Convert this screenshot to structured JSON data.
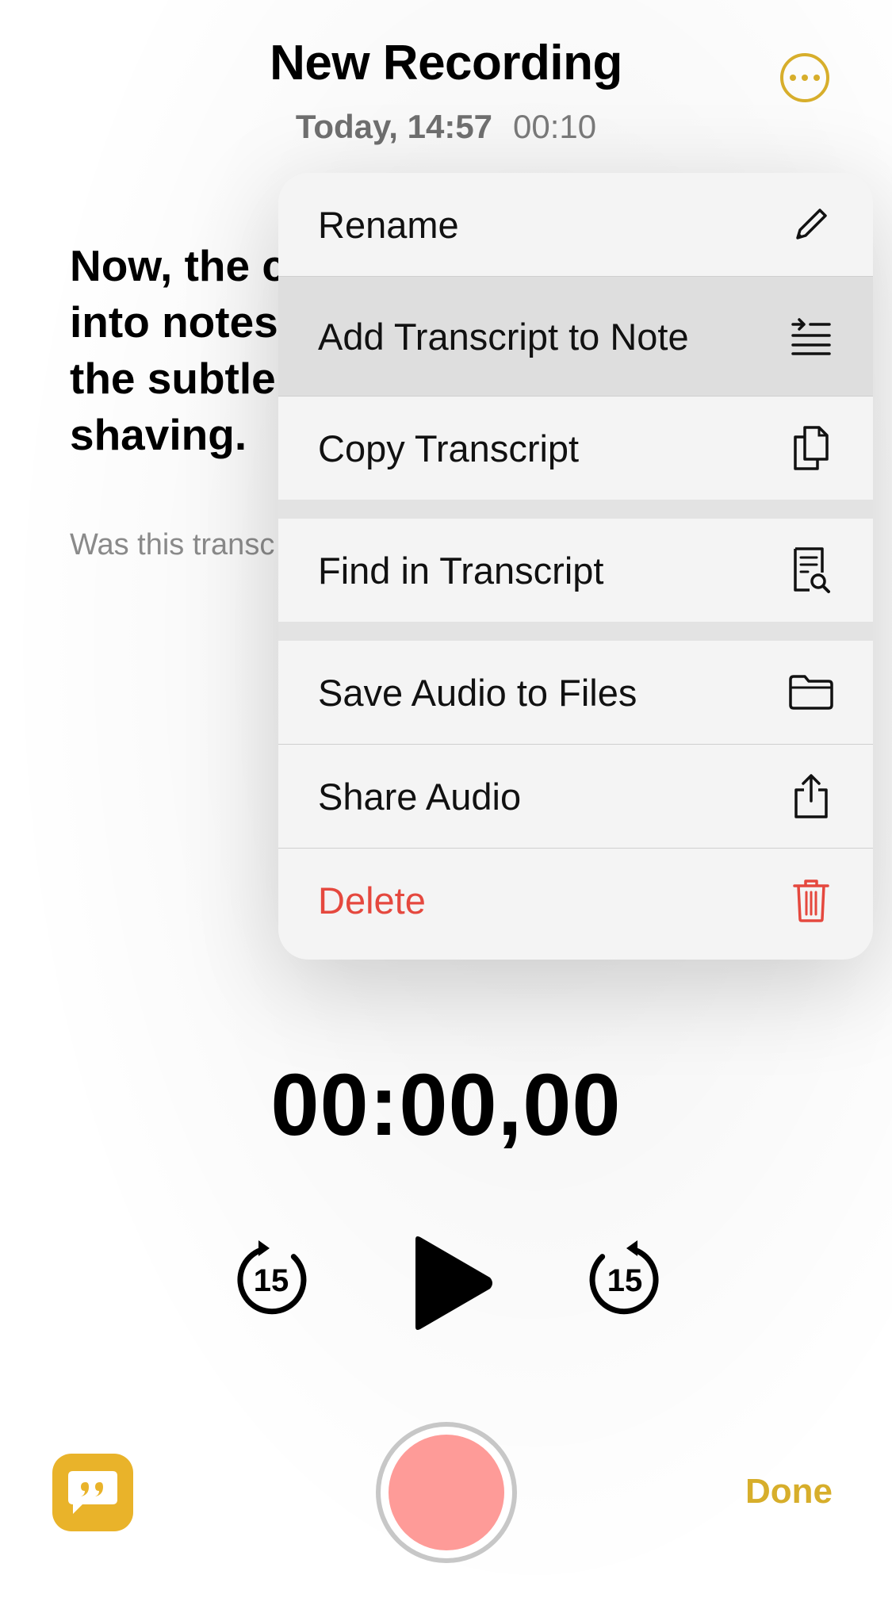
{
  "header": {
    "title": "New Recording",
    "date": "Today, 14:57",
    "duration": "00:10",
    "more_icon": "ellipsis-circle-icon",
    "accent_color": "#d7ae2b"
  },
  "transcript": {
    "lines": [
      "Now, the c",
      "into notes",
      "the subtle",
      "shaving."
    ],
    "feedback": "Was this transc"
  },
  "menu": {
    "items": [
      {
        "label": "Rename",
        "icon": "pencil-icon"
      },
      {
        "label": "Add Transcript to Note",
        "icon": "add-to-list-icon"
      },
      {
        "label": "Copy Transcript",
        "icon": "copy-icon"
      },
      {
        "label": "Find in Transcript",
        "icon": "find-document-icon"
      },
      {
        "label": "Save Audio to Files",
        "icon": "folder-icon"
      },
      {
        "label": "Share Audio",
        "icon": "share-icon"
      },
      {
        "label": "Delete",
        "icon": "trash-icon",
        "color": "#e5483e"
      }
    ]
  },
  "player": {
    "time": "00:00,00",
    "skip_back_seconds": "15",
    "skip_forward_seconds": "15"
  },
  "bottom_bar": {
    "done_label": "Done",
    "record_color": "#fe9b98",
    "transcript_button_color": "#e9b32a"
  }
}
